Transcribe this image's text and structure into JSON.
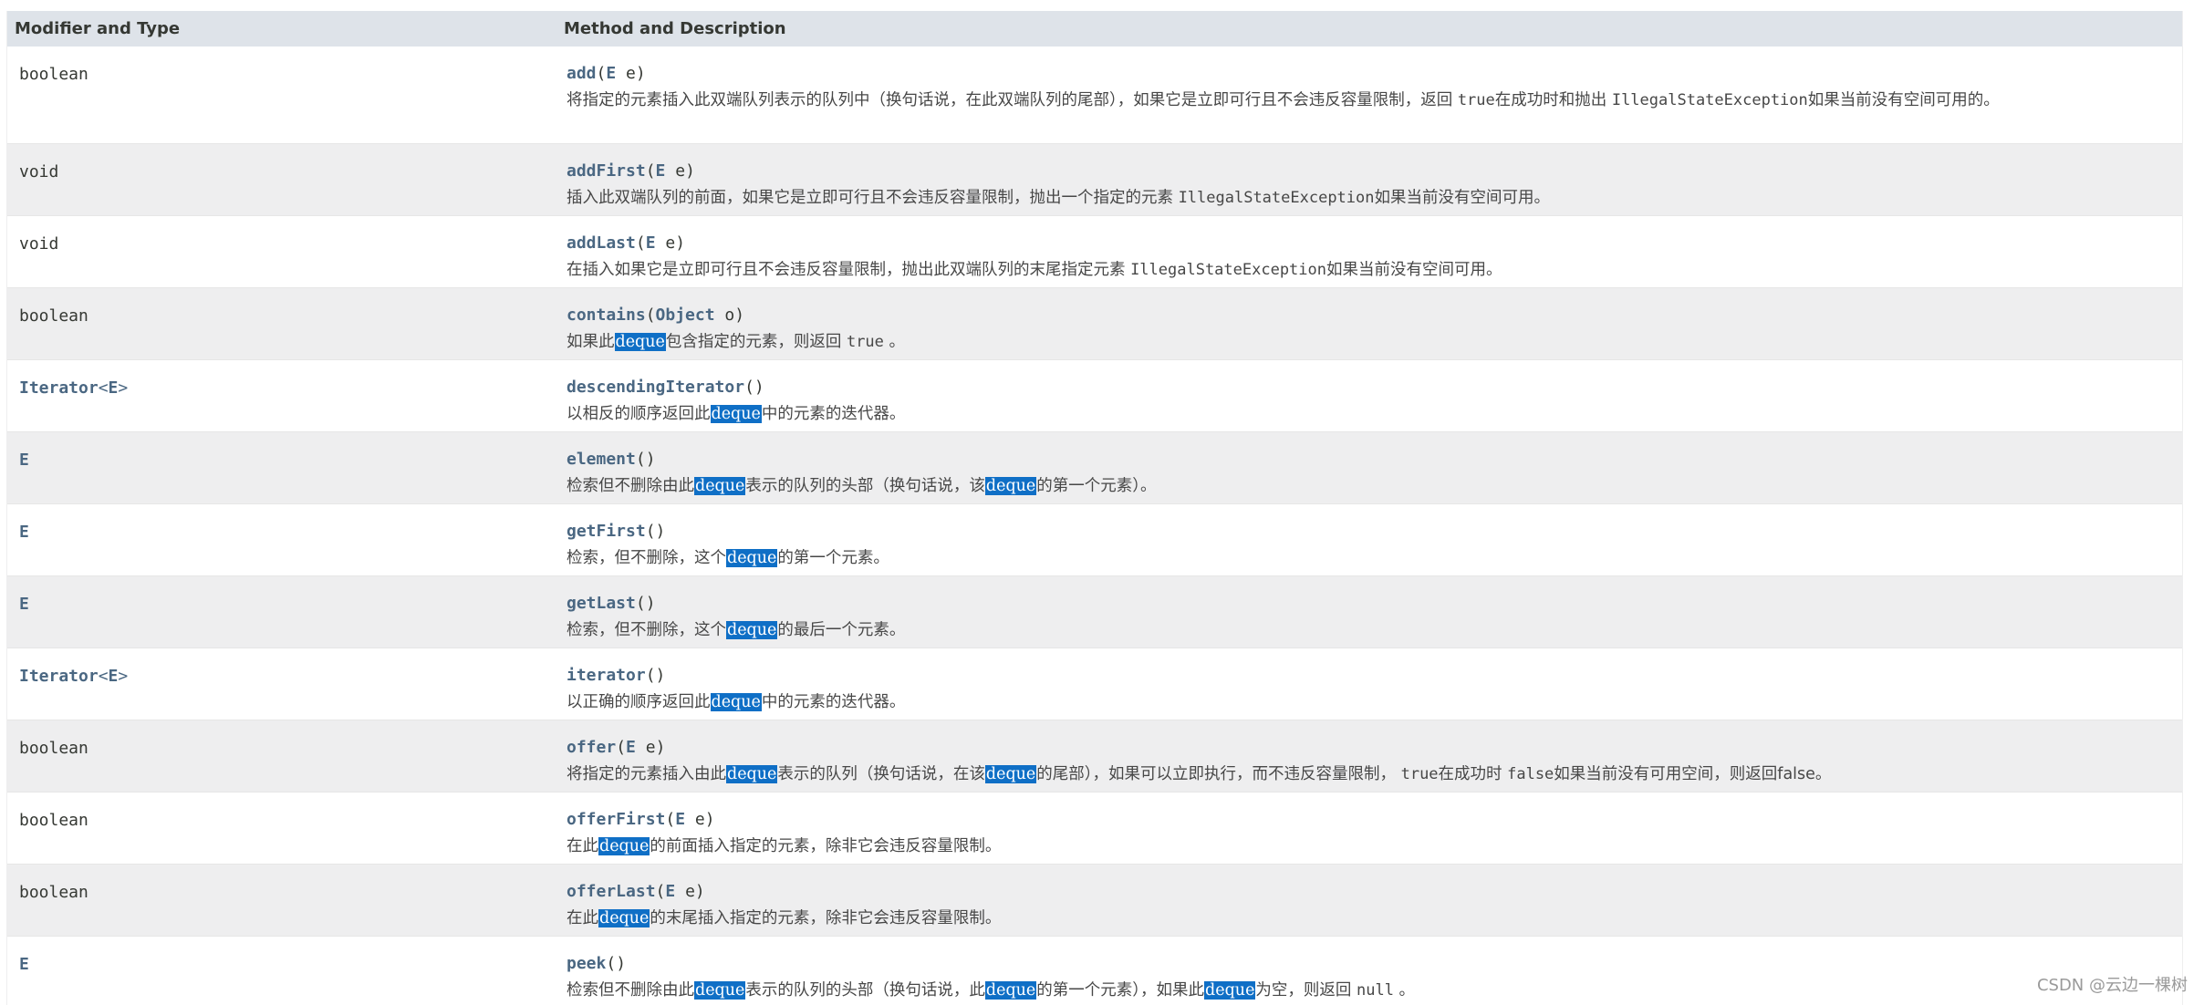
{
  "header": {
    "col1": "Modifier and Type",
    "col2": "Method and Description"
  },
  "rows": [
    {
      "type": "boolean",
      "method": "add",
      "params": [
        {
          "type": "E",
          "name": "e"
        }
      ],
      "desc": [
        {
          "t": "text",
          "v": "将指定的元素插入此双端队列表示的队列中（换句话说，在此双端队列的尾部），如果它是立即可行且不会违反容量限制，返回 "
        },
        {
          "t": "code",
          "v": "true"
        },
        {
          "t": "text",
          "v": "在成功时和抛出 "
        },
        {
          "t": "code",
          "v": "IllegalStateException"
        },
        {
          "t": "text",
          "v": "如果当前没有空间可用的。"
        }
      ]
    },
    {
      "type": "void",
      "method": "addFirst",
      "params": [
        {
          "type": "E",
          "name": "e"
        }
      ],
      "desc": [
        {
          "t": "text",
          "v": "插入此双端队列的前面，如果它是立即可行且不会违反容量限制，抛出一个指定的元素 "
        },
        {
          "t": "code",
          "v": "IllegalStateException"
        },
        {
          "t": "text",
          "v": "如果当前没有空间可用。"
        }
      ]
    },
    {
      "type": "void",
      "method": "addLast",
      "params": [
        {
          "type": "E",
          "name": "e"
        }
      ],
      "desc": [
        {
          "t": "text",
          "v": "在插入如果它是立即可行且不会违反容量限制，抛出此双端队列的末尾指定元素 "
        },
        {
          "t": "code",
          "v": "IllegalStateException"
        },
        {
          "t": "text",
          "v": "如果当前没有空间可用。"
        }
      ]
    },
    {
      "type": "boolean",
      "method": "contains",
      "params": [
        {
          "type": "Object",
          "name": "o"
        }
      ],
      "desc": [
        {
          "t": "text",
          "v": "如果此"
        },
        {
          "t": "hl",
          "v": "deque"
        },
        {
          "t": "text",
          "v": "包含指定的元素，则返回 "
        },
        {
          "t": "code",
          "v": "true"
        },
        {
          "t": "text",
          "v": " 。"
        }
      ]
    },
    {
      "type": "Iterator<E>",
      "typeLink": true,
      "method": "descendingIterator",
      "params": [],
      "desc": [
        {
          "t": "text",
          "v": "以相反的顺序返回此"
        },
        {
          "t": "hl",
          "v": "deque"
        },
        {
          "t": "text",
          "v": "中的元素的迭代器。"
        }
      ]
    },
    {
      "type": "E",
      "typeLink": true,
      "method": "element",
      "params": [],
      "desc": [
        {
          "t": "text",
          "v": "检索但不删除由此"
        },
        {
          "t": "hl",
          "v": "deque"
        },
        {
          "t": "text",
          "v": "表示的队列的头部（换句话说，该"
        },
        {
          "t": "hl",
          "v": "deque"
        },
        {
          "t": "text",
          "v": "的第一个元素）。"
        }
      ]
    },
    {
      "type": "E",
      "typeLink": true,
      "method": "getFirst",
      "params": [],
      "desc": [
        {
          "t": "text",
          "v": "检索，但不删除，这个"
        },
        {
          "t": "hl",
          "v": "deque"
        },
        {
          "t": "text",
          "v": "的第一个元素。"
        }
      ]
    },
    {
      "type": "E",
      "typeLink": true,
      "method": "getLast",
      "params": [],
      "desc": [
        {
          "t": "text",
          "v": "检索，但不删除，这个"
        },
        {
          "t": "hl",
          "v": "deque"
        },
        {
          "t": "text",
          "v": "的最后一个元素。"
        }
      ]
    },
    {
      "type": "Iterator<E>",
      "typeLink": true,
      "method": "iterator",
      "params": [],
      "desc": [
        {
          "t": "text",
          "v": "以正确的顺序返回此"
        },
        {
          "t": "hl",
          "v": "deque"
        },
        {
          "t": "text",
          "v": "中的元素的迭代器。"
        }
      ]
    },
    {
      "type": "boolean",
      "method": "offer",
      "params": [
        {
          "type": "E",
          "name": "e"
        }
      ],
      "desc": [
        {
          "t": "text",
          "v": "将指定的元素插入由此"
        },
        {
          "t": "hl",
          "v": "deque"
        },
        {
          "t": "text",
          "v": "表示的队列（换句话说，在该"
        },
        {
          "t": "hl",
          "v": "deque"
        },
        {
          "t": "text",
          "v": "的尾部），如果可以立即执行，而不违反容量限制， "
        },
        {
          "t": "code",
          "v": "true"
        },
        {
          "t": "text",
          "v": "在成功时 "
        },
        {
          "t": "code",
          "v": "false"
        },
        {
          "t": "text",
          "v": "如果当前没有可用空间，则返回false。"
        }
      ]
    },
    {
      "type": "boolean",
      "method": "offerFirst",
      "params": [
        {
          "type": "E",
          "name": "e"
        }
      ],
      "desc": [
        {
          "t": "text",
          "v": "在此"
        },
        {
          "t": "hl",
          "v": "deque"
        },
        {
          "t": "text",
          "v": "的前面插入指定的元素，除非它会违反容量限制。"
        }
      ]
    },
    {
      "type": "boolean",
      "method": "offerLast",
      "params": [
        {
          "type": "E",
          "name": "e"
        }
      ],
      "desc": [
        {
          "t": "text",
          "v": "在此"
        },
        {
          "t": "hl",
          "v": "deque"
        },
        {
          "t": "text",
          "v": "的末尾插入指定的元素，除非它会违反容量限制。"
        }
      ]
    },
    {
      "type": "E",
      "typeLink": true,
      "method": "peek",
      "params": [],
      "desc": [
        {
          "t": "text",
          "v": "检索但不删除由此"
        },
        {
          "t": "hl",
          "v": "deque"
        },
        {
          "t": "text",
          "v": "表示的队列的头部（换句话说，此"
        },
        {
          "t": "hl",
          "v": "deque"
        },
        {
          "t": "text",
          "v": "的第一个元素），如果此"
        },
        {
          "t": "hl",
          "v": "deque"
        },
        {
          "t": "text",
          "v": "为空，则返回 "
        },
        {
          "t": "code",
          "v": "null"
        },
        {
          "t": "text",
          "v": " 。"
        }
      ]
    }
  ],
  "watermark": "CSDN @云边一棵树"
}
